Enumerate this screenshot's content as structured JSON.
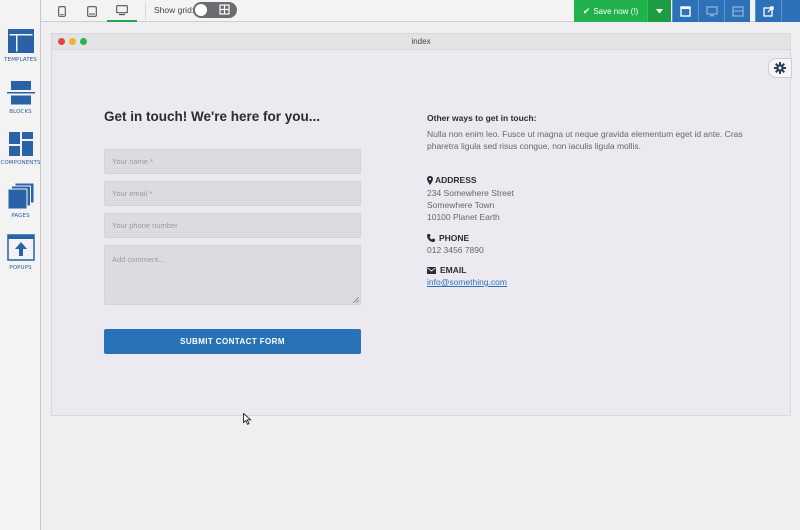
{
  "sidebar": {
    "items": [
      {
        "label": "TEMPLATES",
        "icon": "templates-icon"
      },
      {
        "label": "BLOCKS",
        "icon": "blocks-icon"
      },
      {
        "label": "COMPONENTS",
        "icon": "components-icon"
      },
      {
        "label": "PAGES",
        "icon": "pages-icon"
      },
      {
        "label": "POPUPS",
        "icon": "popups-icon"
      }
    ]
  },
  "toolbar": {
    "devices": [
      "mobile",
      "tablet",
      "desktop"
    ],
    "active_device": "desktop",
    "show_grid_label": "Show grid:",
    "show_grid_on": false,
    "save_label": "Save now (!)",
    "colors": {
      "save": "#22b24c",
      "tools": "#2d72b8"
    }
  },
  "frame": {
    "title": "index"
  },
  "form": {
    "heading": "Get in touch! We're here for you...",
    "name_placeholder": "Your name *",
    "email_placeholder": "Your email *",
    "phone_placeholder": "Your phone number",
    "comment_placeholder": "Add comment...",
    "submit_label": "SUBMIT CONTACT FORM"
  },
  "contact": {
    "heading": "Other ways to get in touch:",
    "text": "Nulla non enim leo. Fusce ut magna ut neque gravida elementum eget id ante. Cras pharetra ligula sed risus congue, non iaculis ligula mollis.",
    "address_label": "ADDRESS",
    "address_lines": [
      "234 Somewhere Street",
      "Somewhere Town",
      "10100 Planet Earth"
    ],
    "phone_label": "PHONE",
    "phone": "012 3456 7890",
    "email_label": "EMAIL",
    "email": "info@something.com"
  }
}
